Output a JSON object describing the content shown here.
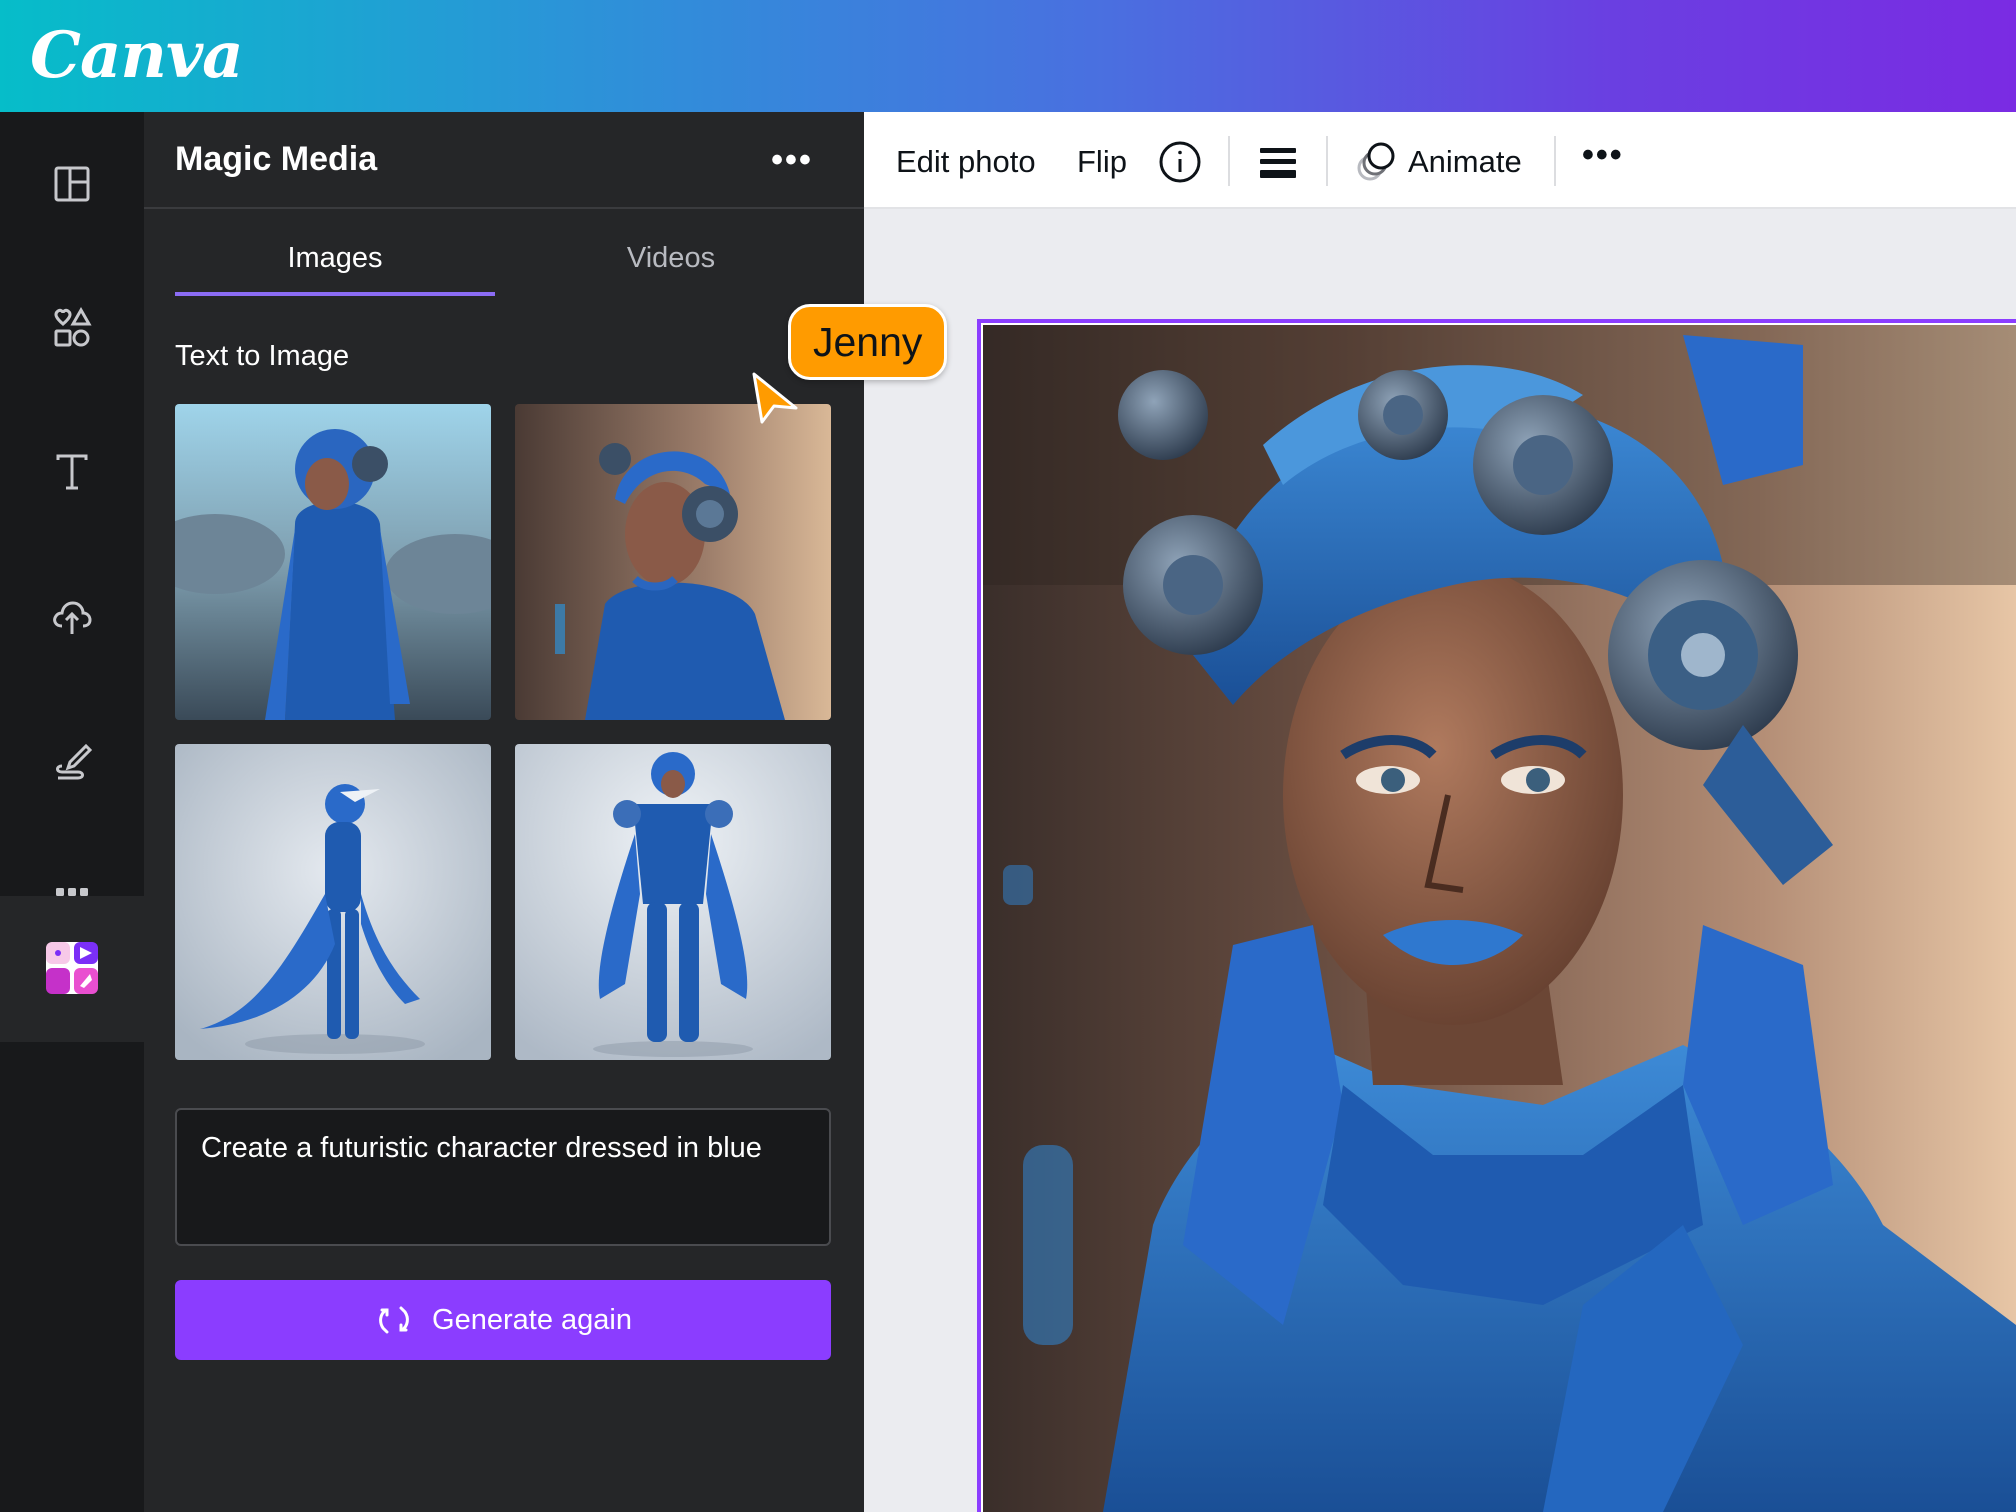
{
  "app": {
    "logo_text": "Canva"
  },
  "rail": {
    "items": [
      {
        "icon": "layout-icon"
      },
      {
        "icon": "elements-icon"
      },
      {
        "icon": "text-icon"
      },
      {
        "icon": "upload-cloud-icon"
      },
      {
        "icon": "draw-icon"
      },
      {
        "icon": "apps-grid-icon"
      },
      {
        "icon": "magic-media-icon",
        "active": true
      }
    ]
  },
  "panel": {
    "title": "Magic Media",
    "more": "•••",
    "tabs": [
      {
        "label": "Images",
        "active": true
      },
      {
        "label": "Videos",
        "active": false
      }
    ],
    "section_label": "Text to Image",
    "prompt": "Create a futuristic character dressed in blue",
    "generate_label": "Generate again"
  },
  "toolbar": {
    "edit_photo": "Edit photo",
    "flip": "Flip",
    "animate": "Animate",
    "more": "•••"
  },
  "collaborator": {
    "name": "Jenny",
    "color": "#ff9b00"
  },
  "colors": {
    "accent": "#8b3dff",
    "tab_underline": "#8b6cf5",
    "panel_bg": "#252628",
    "rail_bg": "#18191b"
  }
}
